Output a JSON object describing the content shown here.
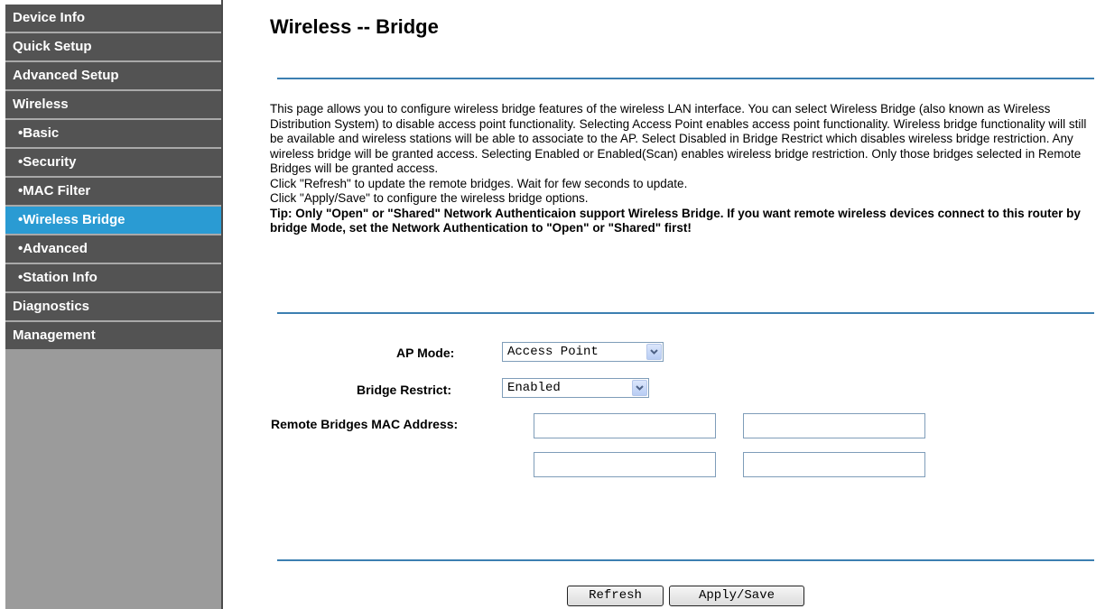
{
  "sidebar": {
    "items": [
      {
        "label": "Device Info"
      },
      {
        "label": "Quick Setup"
      },
      {
        "label": "Advanced Setup"
      },
      {
        "label": "Wireless"
      },
      {
        "label": "•Basic"
      },
      {
        "label": "•Security"
      },
      {
        "label": "•MAC Filter"
      },
      {
        "label": "•Wireless Bridge"
      },
      {
        "label": "•Advanced"
      },
      {
        "label": "•Station Info"
      },
      {
        "label": "Diagnostics"
      },
      {
        "label": "Management"
      }
    ]
  },
  "main": {
    "title": "Wireless -- Bridge",
    "description": [
      "This page allows you to configure wireless bridge features of the wireless LAN interface. You can select Wireless Bridge (also known as Wireless Distribution System) to disable access point functionality. Selecting Access Point enables access point functionality. Wireless bridge functionality will still be available and wireless stations will be able to associate to the AP. Select Disabled in Bridge Restrict which disables wireless bridge restriction. Any wireless bridge will be granted access. Selecting Enabled or Enabled(Scan) enables wireless bridge restriction. Only those bridges selected in Remote Bridges will be granted access.",
      "Click \"Refresh\" to update the remote bridges. Wait for few seconds to update.",
      "Click \"Apply/Save\" to configure the wireless bridge options."
    ],
    "tip": "Tip: Only \"Open\" or \"Shared\" Network Authenticaion support Wireless Bridge. If you want remote wireless devices connect to this router by bridge Mode, set the Network Authentication to \"Open\" or \"Shared\" first!"
  },
  "form": {
    "ap_mode_label": "AP Mode:",
    "ap_mode_value": "Access Point",
    "bridge_restrict_label": "Bridge Restrict:",
    "bridge_restrict_value": "Enabled",
    "remote_mac_label": "Remote Bridges MAC Address:",
    "mac_values": [
      "",
      "",
      "",
      ""
    ]
  },
  "buttons": {
    "refresh": "Refresh",
    "apply_save": "Apply/Save"
  },
  "colors": {
    "nav_bg": "#535353",
    "nav_active": "#2a9bd3",
    "sidebar_bg": "#9b9b9b",
    "rule": "#3c7fb1"
  }
}
